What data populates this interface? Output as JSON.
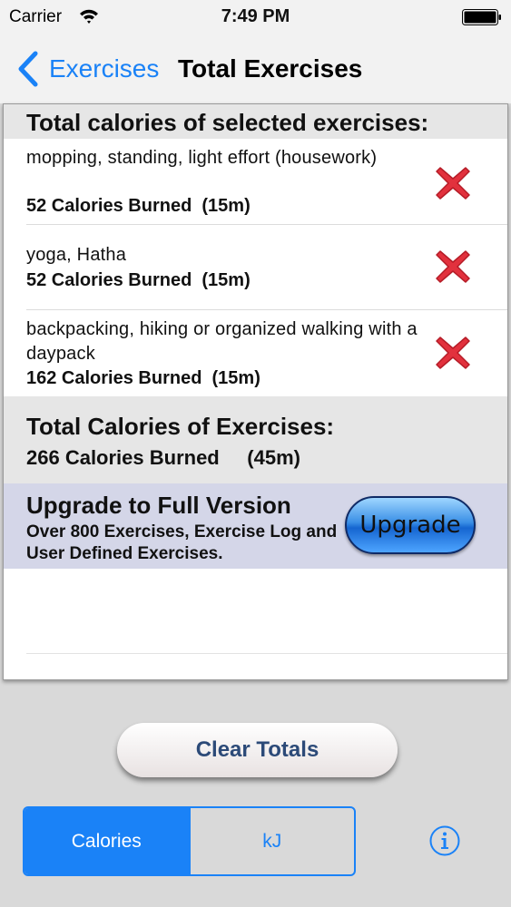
{
  "status_bar": {
    "carrier": "Carrier",
    "time": "7:49 PM"
  },
  "nav": {
    "back_label": "Exercises",
    "title": "Total Exercises"
  },
  "section_header": "Total calories of selected exercises:",
  "exercises": [
    {
      "name": "mopping, standing, light effort (housework)",
      "calories": "52 Calories Burned  (15m)"
    },
    {
      "name": "yoga, Hatha",
      "calories": "52 Calories Burned  (15m)"
    },
    {
      "name": "backpacking, hiking or organized walking with a daypack",
      "calories": "162 Calories Burned  (15m)"
    }
  ],
  "totals": {
    "title": "Total Calories of Exercises:",
    "value": "266 Calories Burned     (45m)"
  },
  "upgrade": {
    "title": "Upgrade to Full Version",
    "description": "Over 800 Exercises, Exercise Log and User Defined Exercises.",
    "button_label": "Upgrade"
  },
  "clear_button_label": "Clear Totals",
  "units": {
    "options": [
      "Calories",
      "kJ"
    ],
    "selected": "Calories"
  },
  "colors": {
    "accent": "#1a82f7",
    "delete": "#e2313d",
    "upgrade_banner": "#d4d6e8"
  },
  "icons": [
    "wifi-icon",
    "battery-icon",
    "back-chevron-icon",
    "delete-icon",
    "info-icon"
  ]
}
